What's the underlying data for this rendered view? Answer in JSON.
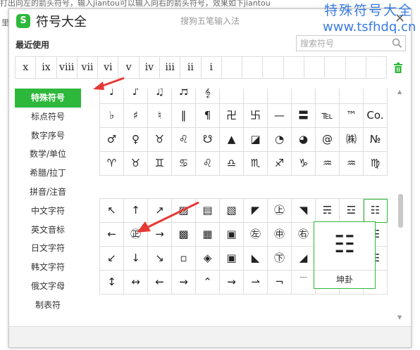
{
  "background": {
    "line1": "打出向左的箭头符号，输入jiantou可以输入向右的箭头符号，效果如下jiantou",
    "line2": "里"
  },
  "watermark": {
    "line1": "特殊符号大全",
    "line2": "www.tsfhdq.cn"
  },
  "window": {
    "logo": "S",
    "title": "符号大全",
    "subtitle": "搜狗五笔输入法",
    "close": "✕"
  },
  "recent": {
    "label": "最近使用",
    "items": [
      "x",
      "ix",
      "viii",
      "vii",
      "vi",
      "v",
      "iv",
      "iii",
      "ii",
      "i",
      "",
      "",
      "",
      "",
      "",
      "",
      "",
      ""
    ]
  },
  "search": {
    "placeholder": "搜索符号"
  },
  "sidebar": {
    "items": [
      {
        "label": "特殊符号",
        "active": true
      },
      {
        "label": "标点符号"
      },
      {
        "label": "数字序号"
      },
      {
        "label": "数学/单位"
      },
      {
        "label": "希腊/拉丁"
      },
      {
        "label": "拼音/注音"
      },
      {
        "label": "中文字符"
      },
      {
        "label": "英文音标"
      },
      {
        "label": "日文字符"
      },
      {
        "label": "韩文字符"
      },
      {
        "label": "俄文字母"
      },
      {
        "label": "制表符"
      }
    ]
  },
  "grid_top": {
    "rows": [
      [
        "♩",
        "♪",
        "♫",
        "♬",
        "𝄞",
        "",
        "",
        "",
        "",
        "",
        "",
        ""
      ],
      [
        "♭",
        "♯",
        "♮",
        "‖",
        "¶",
        "卍",
        "卐",
        "—",
        "〓",
        "℡",
        "™",
        "Co."
      ],
      [
        "♂",
        "♀",
        "♉",
        "♌",
        "☋",
        "▲",
        "◪",
        "◔",
        "◕",
        "@",
        "㈱",
        "№"
      ],
      [
        "♈",
        "♉",
        "♊",
        "♋",
        "♌",
        "♎",
        "♏",
        "♐",
        "♑",
        "♒",
        "♒",
        "♍"
      ]
    ]
  },
  "grid_bottom": {
    "rows": [
      [
        "↖",
        "↑",
        "↗",
        "▨",
        "▤",
        "▧",
        "◤",
        "㊤",
        "◥",
        "☴",
        "☲",
        "☷"
      ],
      [
        "←",
        "㊣",
        "→",
        "▩",
        "▦",
        "▣",
        "㊧",
        "㊥",
        "㊨",
        "",
        "",
        "☵"
      ],
      [
        "↙",
        "↓",
        "↘",
        "▫",
        "◈",
        "▣",
        "◣",
        "㊦",
        "◢",
        "",
        "",
        "☷"
      ],
      [
        "↕",
        "↔",
        "⇜",
        "⇝",
        "⌃",
        "⇝",
        "⇀",
        "¬",
        "﹉",
        "",
        "",
        ""
      ]
    ]
  },
  "popup": {
    "symbol": "☷",
    "label": "坤卦"
  },
  "colors": {
    "accent": "#2eb83b",
    "watermark": "#3a7be0",
    "arrow": "#e53935"
  }
}
